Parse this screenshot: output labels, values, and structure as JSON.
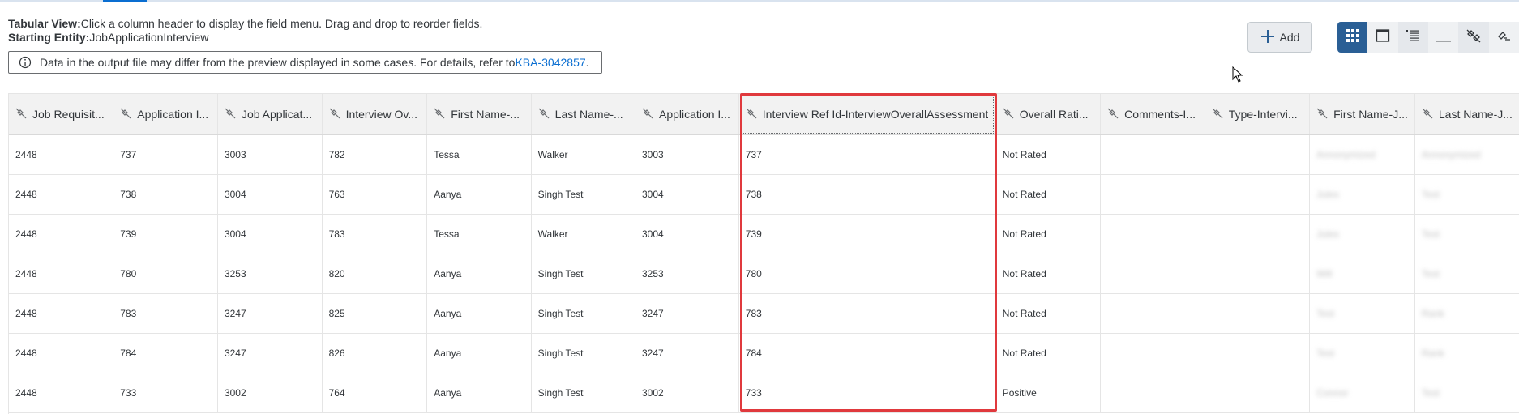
{
  "header": {
    "tabular_label": "Tabular View:",
    "tabular_text": "Click a column header to display the field menu. Drag and drop to reorder fields.",
    "entity_label": "Starting Entity:",
    "entity_text": "JobApplicationInterview"
  },
  "banner": {
    "icon": "info-icon",
    "text": "Data in the output file may differ from the preview displayed in some cases. For details, refer to ",
    "link": "KBA-3042857",
    "suffix": "."
  },
  "toolbar": {
    "add_label": "Add",
    "buttons": [
      "grid-view-icon",
      "panel-view-icon",
      "list-view-icon",
      "minimize-icon",
      "unlink-icon",
      "link-icon"
    ]
  },
  "table": {
    "columns": [
      "Job Requisit...",
      "Application I...",
      "Job Applicat...",
      "Interview Ov...",
      "First Name-...",
      "Last Name-...",
      "Application I...",
      "Interview Ref Id-InterviewOverallAssessment",
      "Overall Rati...",
      "Comments-I...",
      "Type-Intervi...",
      "First Name-J...",
      "Last Name-J..."
    ],
    "rows": [
      [
        "2448",
        "737",
        "3003",
        "782",
        "Tessa",
        "Walker",
        "3003",
        "737",
        "Not Rated",
        "",
        "",
        "Annonymized",
        "Annonymized"
      ],
      [
        "2448",
        "738",
        "3004",
        "763",
        "Aanya",
        "Singh Test",
        "3004",
        "738",
        "Not Rated",
        "",
        "",
        "Jules",
        "Test"
      ],
      [
        "2448",
        "739",
        "3004",
        "783",
        "Tessa",
        "Walker",
        "3004",
        "739",
        "Not Rated",
        "",
        "",
        "Jules",
        "Test"
      ],
      [
        "2448",
        "780",
        "3253",
        "820",
        "Aanya",
        "Singh Test",
        "3253",
        "780",
        "Not Rated",
        "",
        "",
        "Will",
        "Test"
      ],
      [
        "2448",
        "783",
        "3247",
        "825",
        "Aanya",
        "Singh Test",
        "3247",
        "783",
        "Not Rated",
        "",
        "",
        "Test",
        "Rank"
      ],
      [
        "2448",
        "784",
        "3247",
        "826",
        "Aanya",
        "Singh Test",
        "3247",
        "784",
        "Not Rated",
        "",
        "",
        "Test",
        "Rank"
      ],
      [
        "2448",
        "733",
        "3002",
        "764",
        "Aanya",
        "Singh Test",
        "3002",
        "733",
        "Positive",
        "",
        "",
        "Connor",
        "Test"
      ]
    ]
  },
  "colors": {
    "accent": "#0a6ed1",
    "highlight": "#e0393d",
    "active_toolbar": "#2a5f95"
  }
}
